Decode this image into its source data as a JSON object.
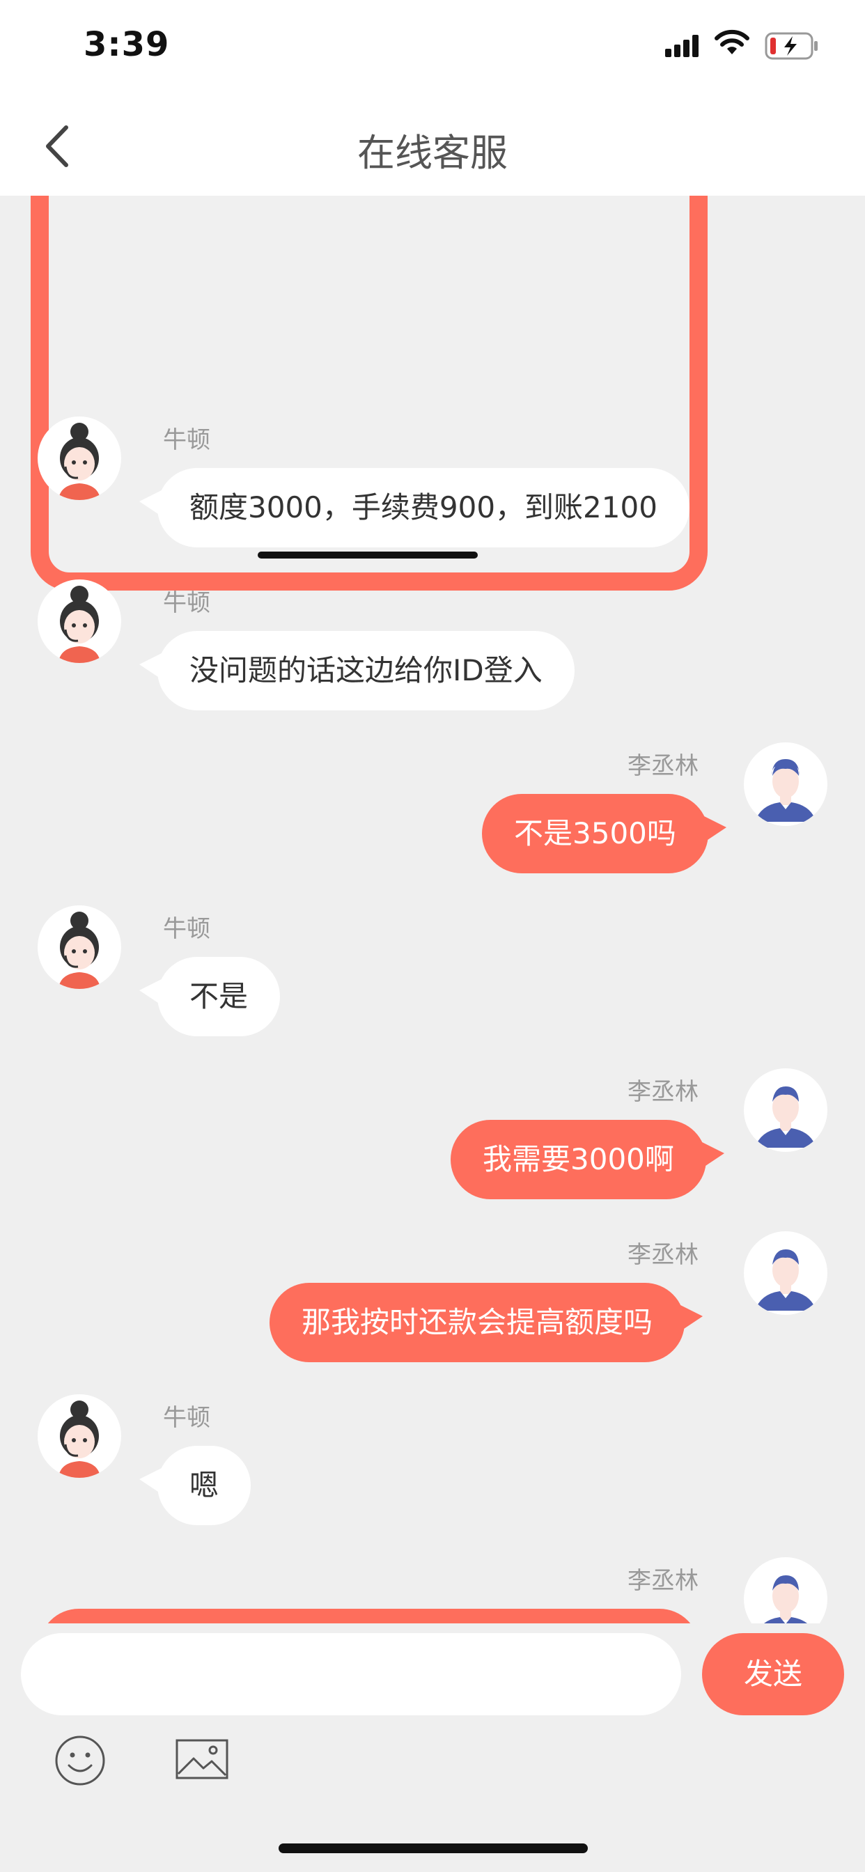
{
  "status": {
    "time": "3:39"
  },
  "nav": {
    "title": "在线客服",
    "back_icon": "chevron-left-icon"
  },
  "colors": {
    "accent": "#fe6e5c",
    "bubble_left": "#ffffff",
    "background": "#efefef"
  },
  "messages": [
    {
      "side": "left",
      "sender": "牛顿",
      "text": "额度3000，手续费900，到账2100"
    },
    {
      "side": "left",
      "sender": "牛顿",
      "text": "没问题的话这边给你ID登入"
    },
    {
      "side": "right",
      "sender": "李丞林",
      "text": "不是3500吗"
    },
    {
      "side": "left",
      "sender": "牛顿",
      "text": "不是"
    },
    {
      "side": "right",
      "sender": "李丞林",
      "text": "我需要3000啊"
    },
    {
      "side": "right",
      "sender": "李丞林",
      "text": "那我按时还款会提高额度吗"
    },
    {
      "side": "left",
      "sender": "牛顿",
      "text": "嗯"
    },
    {
      "side": "right",
      "sender": "李丞林",
      "text": ""
    }
  ],
  "composer": {
    "input_value": "",
    "send_label": "发送"
  },
  "toolbar": {
    "emoji_icon": "smiley-icon",
    "image_icon": "image-icon"
  }
}
